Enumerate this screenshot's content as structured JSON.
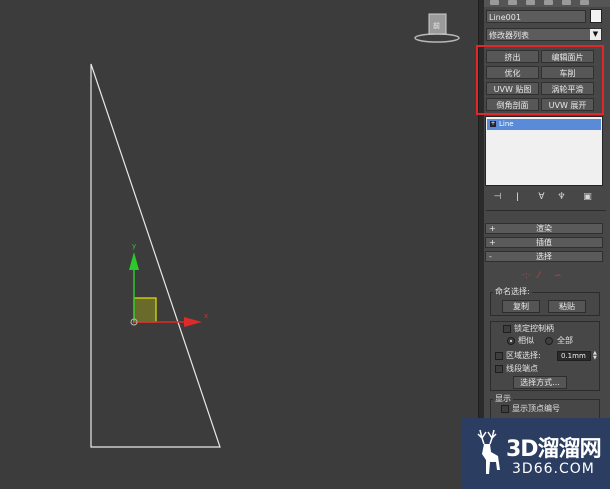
{
  "viewport": {
    "gizmo": {
      "x_label": "x",
      "y_label": "y"
    },
    "viewcube_label": "前"
  },
  "panel": {
    "object_name": "Line001",
    "modifier_list": "修改器列表",
    "modifier_buttons": [
      {
        "label": "挤出"
      },
      {
        "label": "编辑面片"
      },
      {
        "label": "优化"
      },
      {
        "label": "车削"
      },
      {
        "label": "UVW 贴图"
      },
      {
        "label": "涡轮平滑"
      },
      {
        "label": "倒角剖面"
      },
      {
        "label": "UVW 展开"
      }
    ],
    "stack_item": "Line",
    "rollouts": {
      "render": {
        "sign": "+",
        "label": "渲染"
      },
      "interp": {
        "sign": "+",
        "label": "插值"
      },
      "select": {
        "sign": "-",
        "label": "选择"
      }
    },
    "named_selection": {
      "title": "命名选择:",
      "copy": "复制",
      "paste": "粘贴"
    },
    "options": {
      "lock_handles": "锁定控制柄",
      "similar": "相似",
      "all": "全部",
      "area_select": "区域选择:",
      "area_value": "0.1mm",
      "segment_end": "线段端点",
      "select_by": "选择方式..."
    },
    "display": {
      "title": "显示",
      "show_vertex_numbers": "显示顶点编号"
    }
  },
  "watermark": {
    "title": "3D溜溜网",
    "subtitle": "3D66.COM"
  },
  "colors": {
    "highlight_border": "#e0282a",
    "viewport_bg": "#3c3c3c",
    "panel_bg": "#474747",
    "stack_selected": "#5a8bd8",
    "watermark_bg": "#2b3e62"
  }
}
